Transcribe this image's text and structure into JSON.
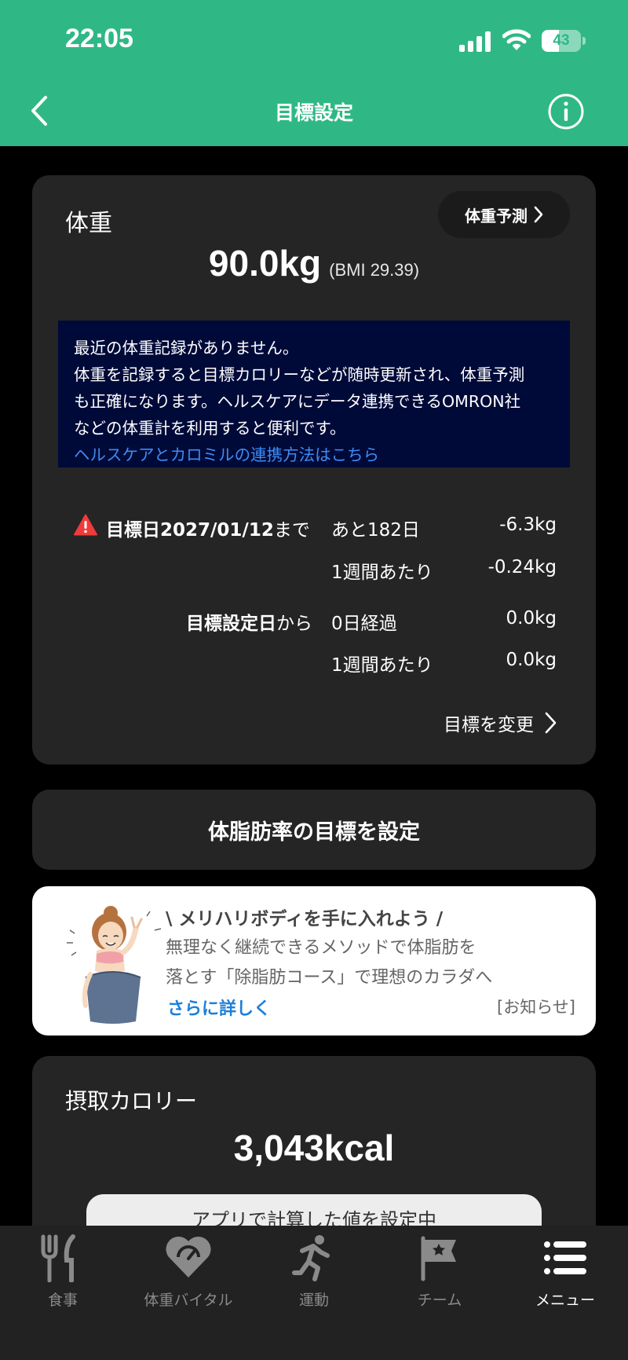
{
  "status_bar": {
    "time": "22:05",
    "battery": "43",
    "battery_level": 0.43
  },
  "nav": {
    "title": "目標設定"
  },
  "weight": {
    "label": "体重",
    "predict_button": "体重予測",
    "value": "90.0kg",
    "bmi": "(BMI 29.39)",
    "notice_lines": [
      "最近の体重記録がありません。",
      "体重を記録すると目標カロリーなどが随時更新され、体重予測",
      "も正確になります。ヘルスケアにデータ連携できるOMRON社",
      "などの体重計を利用すると便利です。"
    ],
    "notice_link": "ヘルスケアとカロミルの連携方法はこちら",
    "target": {
      "label_bold": "目標日2027/01/12",
      "label_suffix": "まで",
      "remaining_days": "あと182日",
      "remaining_weight": "-6.3kg",
      "per_week_label": "1週間あたり",
      "per_week_value": "-0.24kg"
    },
    "since_set": {
      "label_bold": "目標設定日",
      "label_suffix": "から",
      "elapsed": "0日経過",
      "change": "0.0kg",
      "per_week_label": "1週間あたり",
      "per_week_value": "0.0kg"
    },
    "change_goal": "目標を変更"
  },
  "body_fat": {
    "button": "体脂肪率の目標を設定"
  },
  "ad": {
    "title": "\\ メリハリボディを手に入れよう /",
    "line1": "無理なく継続できるメソッドで体脂肪を",
    "line2": "落とす「除脂肪コース」で理想のカラダへ",
    "more": "さらに詳しく",
    "tag": "[お知らせ]"
  },
  "calories": {
    "label": "摂取カロリー",
    "value": "3,043kcal",
    "button": "アプリで計算した値を設定中"
  },
  "tabs": [
    {
      "label": "食事",
      "icon": "fork-knife-icon"
    },
    {
      "label": "体重バイタル",
      "icon": "heart-scale-icon"
    },
    {
      "label": "運動",
      "icon": "running-icon"
    },
    {
      "label": "チーム",
      "icon": "flag-icon"
    },
    {
      "label": "メニュー",
      "icon": "menu-icon",
      "active": true
    }
  ]
}
